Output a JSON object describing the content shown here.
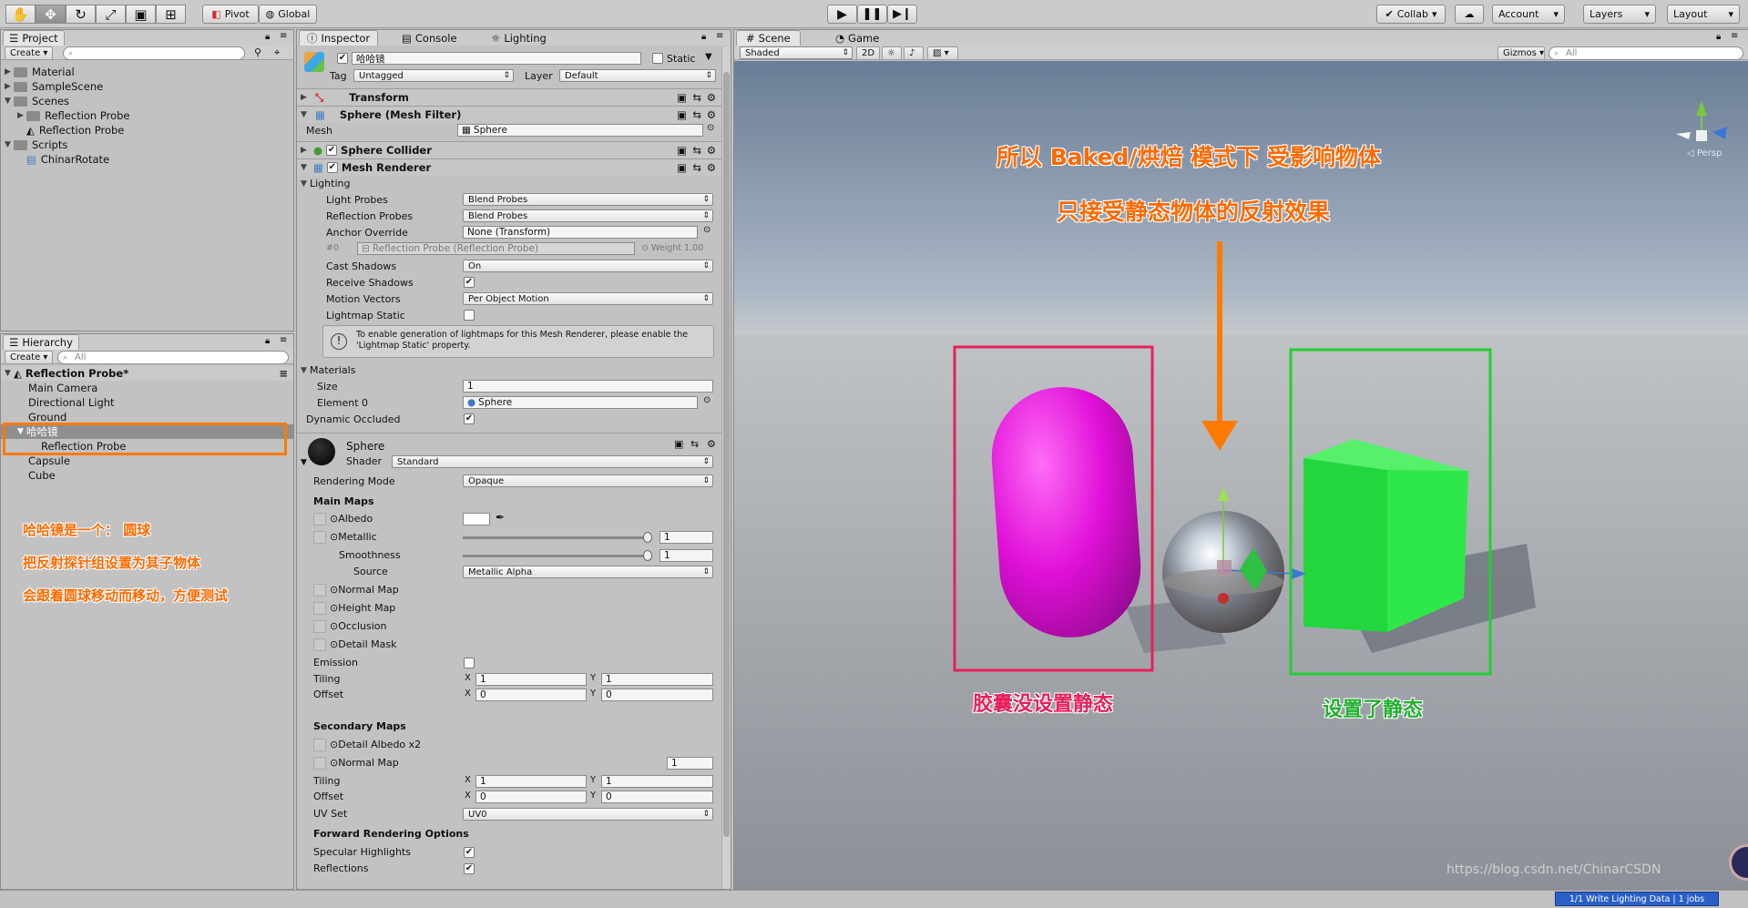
{
  "toolbar": {
    "tools": [
      "hand-tool",
      "move-tool",
      "rotate-tool",
      "scale-tool",
      "rect-tool",
      "transform-tool"
    ],
    "pivot": "Pivot",
    "global": "Global",
    "collab": "Collab",
    "account": "Account",
    "layers": "Layers",
    "layout": "Layout"
  },
  "project": {
    "tab": "Project",
    "create": "Create",
    "items": [
      {
        "label": "Material",
        "indent": 0,
        "arrow": "▶",
        "icon": "folder"
      },
      {
        "label": "SampleScene",
        "indent": 0,
        "arrow": "▶",
        "icon": "folder"
      },
      {
        "label": "Scenes",
        "indent": 0,
        "arrow": "▼",
        "icon": "folder"
      },
      {
        "label": "Reflection Probe",
        "indent": 1,
        "arrow": "▶",
        "icon": "folder"
      },
      {
        "label": "Reflection Probe",
        "indent": 1,
        "arrow": "",
        "icon": "unity"
      },
      {
        "label": "Scripts",
        "indent": 0,
        "arrow": "▼",
        "icon": "folder"
      },
      {
        "label": "ChinarRotate",
        "indent": 1,
        "arrow": "",
        "icon": "script"
      }
    ]
  },
  "hierarchy": {
    "tab": "Hierarchy",
    "create": "Create",
    "search_placeholder": "All",
    "scene": "Reflection Probe*",
    "items": [
      {
        "label": "Main Camera",
        "indent": 1,
        "selected": false
      },
      {
        "label": "Directional Light",
        "indent": 1,
        "selected": false
      },
      {
        "label": "Ground",
        "indent": 1,
        "selected": false
      },
      {
        "label": "哈哈镜",
        "indent": 1,
        "selected": true
      },
      {
        "label": "Reflection Probe",
        "indent": 2,
        "selected": false
      },
      {
        "label": "Capsule",
        "indent": 1,
        "selected": false
      },
      {
        "label": "Cube",
        "indent": 1,
        "selected": false
      }
    ],
    "notes": [
      "哈哈镜是一个： 圆球",
      "把反射探针组设置为其子物体",
      "会跟着圆球移动而移动，方便测试"
    ]
  },
  "inspector": {
    "tabs": [
      "Inspector",
      "Console",
      "Lighting"
    ],
    "name": "哈哈镜",
    "static": "Static",
    "tag_label": "Tag",
    "tag": "Untagged",
    "layer_label": "Layer",
    "layer": "Default",
    "transform": "Transform",
    "mesh_filter": "Sphere (Mesh Filter)",
    "mesh_label": "Mesh",
    "mesh": "Sphere",
    "sphere_collider": "Sphere Collider",
    "mesh_renderer": "Mesh Renderer",
    "lighting": "Lighting",
    "light_probes_label": "Light Probes",
    "light_probes": "Blend Probes",
    "reflection_probes_label": "Reflection Probes",
    "reflection_probes": "Blend Probes",
    "anchor_label": "Anchor Override",
    "anchor": "None (Transform)",
    "probe_index": "#0",
    "probe_ref": "Reflection Probe (Reflection Probe)",
    "weight": "Weight 1.00",
    "cast_shadows_label": "Cast Shadows",
    "cast_shadows": "On",
    "receive_shadows_label": "Receive Shadows",
    "motion_vectors_label": "Motion Vectors",
    "motion_vectors": "Per Object Motion",
    "lightmap_static_label": "Lightmap Static",
    "info": "To enable generation of lightmaps for this Mesh Renderer, please enable the 'Lightmap Static' property.",
    "materials": "Materials",
    "size_label": "Size",
    "size": "1",
    "element0_label": "Element 0",
    "element0": "Sphere",
    "dynamic_occluded": "Dynamic Occluded",
    "material_name": "Sphere",
    "shader_label": "Shader",
    "shader": "Standard",
    "rendering_mode_label": "Rendering Mode",
    "rendering_mode": "Opaque",
    "main_maps": "Main Maps",
    "albedo": "Albedo",
    "metallic": "Metallic",
    "metallic_value": "1",
    "smoothness": "Smoothness",
    "smoothness_value": "1",
    "source_label": "Source",
    "source": "Metallic Alpha",
    "normal_map": "Normal Map",
    "height_map": "Height Map",
    "occlusion": "Occlusion",
    "detail_mask": "Detail Mask",
    "emission": "Emission",
    "tiling": "Tiling",
    "offset": "Offset",
    "x": "X",
    "y": "Y",
    "tiling_x": "1",
    "tiling_y": "1",
    "offset_x": "0",
    "offset_y": "0",
    "secondary_maps": "Secondary Maps",
    "detail_albedo": "Detail Albedo x2",
    "normal_map2": "Normal Map",
    "normal_map2_value": "1",
    "tiling2_x": "1",
    "tiling2_y": "1",
    "offset2_x": "0",
    "offset2_y": "0",
    "uv_set_label": "UV Set",
    "uv_set": "UV0",
    "forward": "Forward Rendering Options",
    "specular": "Specular Highlights",
    "reflections": "Reflections"
  },
  "scene": {
    "tabs": [
      "Scene",
      "Game"
    ],
    "shaded": "Shaded",
    "mode_2d": "2D",
    "gizmos": "Gizmos",
    "search_placeholder": "All",
    "persp": "Persp",
    "title1": "所以 Baked/烘焙 模式下 受影响物体",
    "title2": "只接受静态物体的反射效果",
    "capsule_note": "胶囊没设置静态",
    "cube_note": "设置了静态",
    "status": "1/1 Write Lighting Data | 1 jobs",
    "watermark": "https://blog.csdn.net/ChinarCSDN"
  },
  "colors": {
    "capsule": "#e010d8",
    "cube": "#2ee84a",
    "orange": "#ff7a00",
    "pink_box": "#e8205a",
    "green_box": "#22d030"
  }
}
